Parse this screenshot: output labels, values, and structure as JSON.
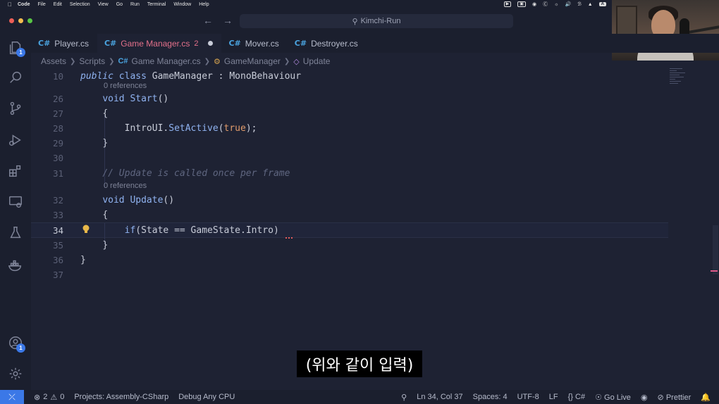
{
  "menubar": {
    "app": "Code",
    "items": [
      "File",
      "Edit",
      "Selection",
      "View",
      "Go",
      "Run",
      "Terminal",
      "Window",
      "Help"
    ],
    "input_badge": "A"
  },
  "titlebar": {
    "search": "Kimchi-Run"
  },
  "activity": {
    "explorer_badge": "1",
    "accounts_badge": "1"
  },
  "tabs": [
    {
      "label": "Player.cs",
      "active": false
    },
    {
      "label": "Game Manager.cs",
      "active": true,
      "problems": "2"
    },
    {
      "label": "Mover.cs",
      "active": false
    },
    {
      "label": "Destroyer.cs",
      "active": false
    }
  ],
  "breadcrumb": {
    "parts": [
      "Assets",
      "Scripts",
      "Game Manager.cs",
      "GameManager",
      "Update"
    ]
  },
  "editor": {
    "lines": [
      {
        "n": "10",
        "text": "public class GameManager : MonoBehaviour"
      },
      {
        "refs": "0 references"
      },
      {
        "n": "26",
        "text": "    void Start()"
      },
      {
        "n": "27",
        "text": "    {"
      },
      {
        "n": "28",
        "text": "        IntroUI.SetActive(true);"
      },
      {
        "n": "29",
        "text": "    }"
      },
      {
        "n": "30",
        "text": ""
      },
      {
        "n": "31",
        "text": "    // Update is called once per frame"
      },
      {
        "refs2": "0 references"
      },
      {
        "n": "32",
        "text": "    void Update()"
      },
      {
        "n": "33",
        "text": "    {"
      },
      {
        "n": "34",
        "text": "        if(State == GameState.Intro)"
      },
      {
        "n": "35",
        "text": "    }"
      },
      {
        "n": "36",
        "text": "}"
      },
      {
        "n": "37",
        "text": ""
      }
    ],
    "tokens": {
      "public": "public",
      "class": "class",
      "class_name": "GameManager",
      "colon": " : ",
      "base": "MonoBehaviour",
      "void": "void",
      "start": "Start",
      "parens": "()",
      "intro_ui": "IntroUI",
      "dot": ".",
      "set_active": "SetActive",
      "lparen": "(",
      "true": "true",
      "rparen_semi": ");",
      "comment": "// Update is called once per frame",
      "update": "Update",
      "if": "if",
      "cond": "(State == GameState.Intro)",
      "lbrace": "{",
      "rbrace": "}"
    }
  },
  "subtitle": "(위와 같이 입력)",
  "statusbar": {
    "errors": "2",
    "warnings": "0",
    "projects": "Projects: Assembly-CSharp",
    "debug": "Debug Any CPU",
    "position": "Ln 34, Col 37",
    "spaces": "Spaces: 4",
    "encoding": "UTF-8",
    "eol": "LF",
    "language": "C#",
    "golive": "Go Live",
    "prettier": "Prettier"
  },
  "colors": {
    "accent": "#3b78e7",
    "modified_tab": "#e2708a",
    "keyword": "#8fb2f0",
    "literal": "#e09b6b"
  }
}
